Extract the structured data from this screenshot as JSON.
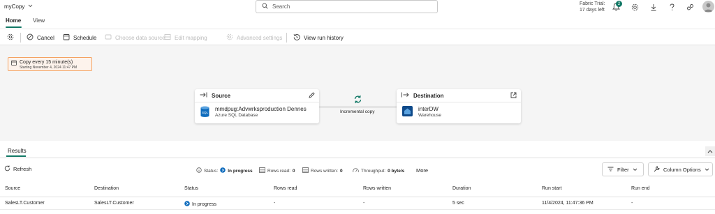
{
  "app": {
    "title": "myCopy"
  },
  "search": {
    "placeholder": "Search"
  },
  "trial": {
    "line1": "Fabric Trial:",
    "line2": "17 days left"
  },
  "notifications": {
    "count": "2"
  },
  "tabs": [
    {
      "label": "Home",
      "active": true
    },
    {
      "label": "View",
      "active": false
    }
  ],
  "toolbar": {
    "cancel": "Cancel",
    "schedule": "Schedule",
    "choose_source": "Choose data source",
    "edit_mapping": "Edit mapping",
    "advanced_settings": "Advanced settings",
    "view_run_history": "View run history"
  },
  "schedule_chip": {
    "line1": "Copy every 15 minute(s)",
    "line2": "Starting November 4, 2024 11:47 PM"
  },
  "source": {
    "header": "Source",
    "name": "mmdpug:Advwrksproduction Dennes",
    "type": "Azure SQL Database",
    "icon_text": "SQL"
  },
  "connector": {
    "label": "Incremental copy"
  },
  "destination": {
    "header": "Destination",
    "name": "interDW",
    "type": "Warehouse"
  },
  "results": {
    "tab": "Results",
    "refresh": "Refresh",
    "status_label": "Status:",
    "status_value": "In progress",
    "rows_read_label": "Rows read:",
    "rows_read_value": "0",
    "rows_written_label": "Rows written:",
    "rows_written_value": "0",
    "throughput_label": "Throughput:",
    "throughput_value": "0 byte/s",
    "more": "More",
    "filter": "Filter",
    "column_options": "Column Options",
    "columns": [
      "Source",
      "Destination",
      "Status",
      "Rows read",
      "Rows written",
      "Duration",
      "Run start",
      "Run end"
    ],
    "rows": [
      {
        "source": "SalesLT.Customer",
        "destination": "SalesLT.Customer",
        "status": "In progress",
        "rows_read": "-",
        "rows_written": "-",
        "duration": "5 sec",
        "run_start": "11/4/2024, 11:47:36 PM",
        "run_end": "-"
      }
    ]
  },
  "colors": {
    "accent": "#117865",
    "progress": "#0f6cbd",
    "schedule_border": "#f4a261"
  }
}
